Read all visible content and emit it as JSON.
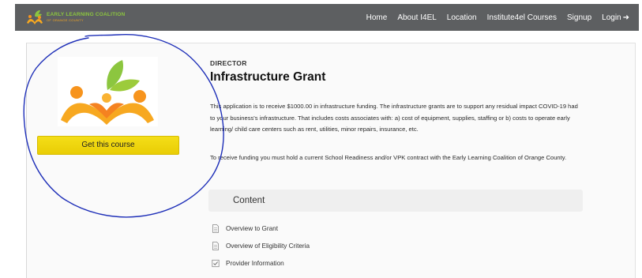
{
  "nav": {
    "brand_line1": "EARLY LEARNING COALITION",
    "brand_line2": "OF ORANGE COUNTY",
    "links": [
      "Home",
      "About I4EL",
      "Location",
      "Institute4el Courses",
      "Signup",
      "Login"
    ],
    "login_icon": "login-arrow-icon"
  },
  "course": {
    "image_icon": "early-learning-logo",
    "cta_label": "Get this course",
    "role": "DIRECTOR",
    "title": "Infrastructure Grant",
    "description": "This application is to receive $1000.00 in infrastructure funding. The infrastructure grants are to support any residual impact COVID-19 had to your business's infrastructure. That includes costs associates with: a) cost of equipment, supplies, staffing or b) costs to operate early learning/ child care centers such as rent, utilities, minor repairs, insurance, etc.",
    "note": "To receive funding you must hold a current School Readiness and/or VPK contract with the Early Learning Coalition of Orange County."
  },
  "content": {
    "heading": "Content",
    "lessons": [
      {
        "label": "Overview to Grant",
        "icon": "document-icon"
      },
      {
        "label": "Overview of Eligibility Criteria",
        "icon": "document-icon"
      },
      {
        "label": "Provider Information",
        "icon": "checkbox-icon"
      }
    ]
  },
  "colors": {
    "navbar": "#5d5f61",
    "cta": "#f4de18",
    "scribble": "#1e2fb8"
  }
}
